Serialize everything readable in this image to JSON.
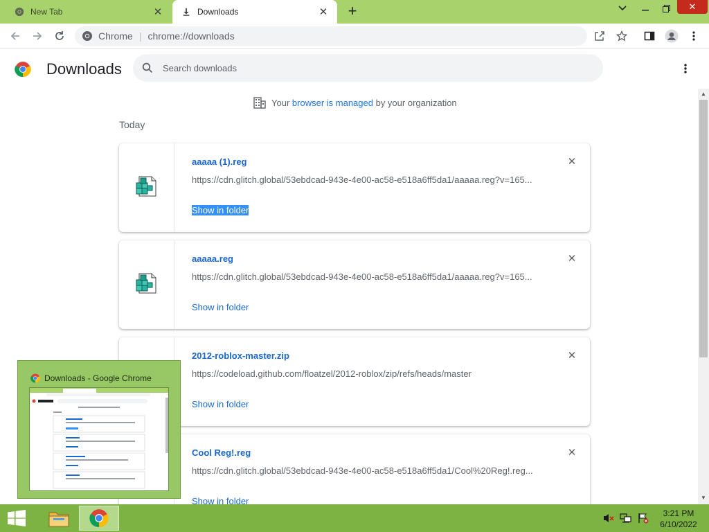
{
  "window": {
    "tabs": [
      {
        "title": "New Tab",
        "active": false
      },
      {
        "title": "Downloads",
        "active": true
      }
    ],
    "new_tab_glyph": "+",
    "controls": {
      "minimize": "⌄",
      "restore": "❐",
      "close": "✕"
    }
  },
  "toolbar": {
    "site_name": "Chrome",
    "separator": "|",
    "url": "chrome://downloads"
  },
  "page": {
    "title": "Downloads",
    "search_placeholder": "Search downloads",
    "managed_notice": {
      "prefix": "Your ",
      "link": "browser is managed",
      "suffix": " by your organization"
    },
    "date_group": "Today"
  },
  "downloads": [
    {
      "name": "aaaaa (1).reg",
      "url": "https://cdn.glitch.global/53ebdcad-943e-4e00-ac58-e518a6ff5da1/aaaaa.reg?v=165...",
      "action": "Show in folder",
      "icon": "registry-file-icon",
      "selected": true
    },
    {
      "name": "aaaaa.reg",
      "url": "https://cdn.glitch.global/53ebdcad-943e-4e00-ac58-e518a6ff5da1/aaaaa.reg?v=165...",
      "action": "Show in folder",
      "icon": "registry-file-icon",
      "selected": false
    },
    {
      "name": "2012-roblox-master.zip",
      "url": "https://codeload.github.com/floatzel/2012-roblox/zip/refs/heads/master",
      "action": "Show in folder",
      "icon": "zip-file-icon",
      "selected": false
    },
    {
      "name": "Cool Reg!.reg",
      "url": "https://cdn.glitch.global/53ebdcad-943e-4e00-ac58-e518a6ff5da1/Cool%20Reg!.reg...",
      "action": "Show in folder",
      "icon": "registry-file-icon",
      "selected": false
    }
  ],
  "taskbar_preview": {
    "title": "Downloads - Google Chrome"
  },
  "taskbar": {
    "time": "3:21 PM",
    "date": "6/10/2022"
  },
  "colors": {
    "tabstrip": "#a8d36c",
    "taskbar": "#7cb342",
    "link": "#1967d2",
    "selection": "#3390ff"
  }
}
